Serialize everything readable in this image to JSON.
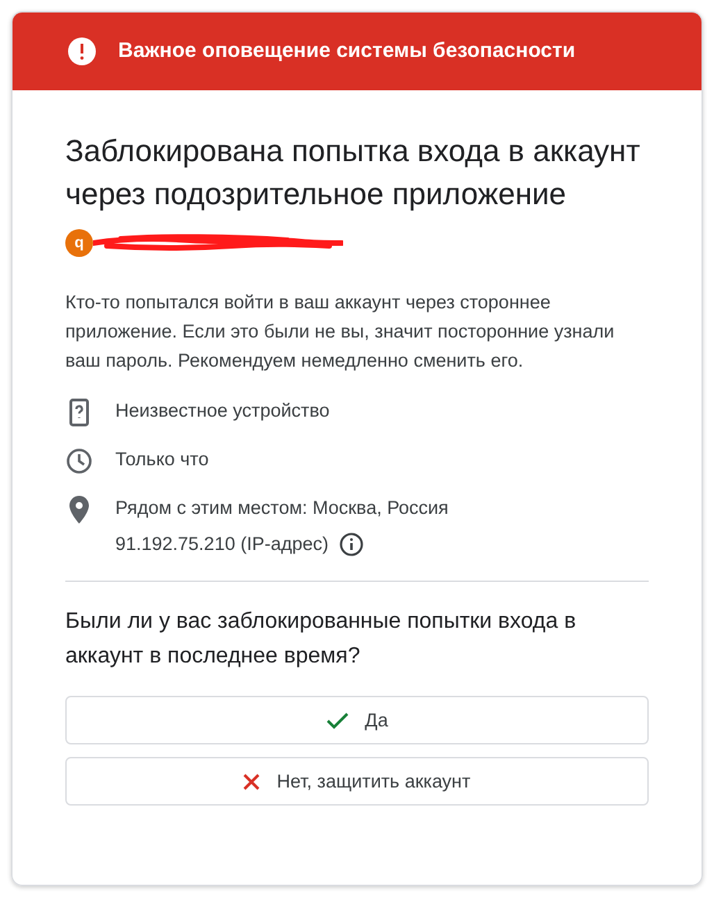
{
  "header": {
    "title": "Важное оповещение системы безопасности"
  },
  "title": "Заблокирована попытка входа в аккаунт через подозрительное приложение",
  "account": {
    "avatar_letter": "q"
  },
  "message": "Кто-то попытался войти в ваш аккаунт через стороннее приложение. Если это были не вы, значит посторонние узнали ваш пароль. Рекомендуем немедленно сменить его.",
  "details": [
    {
      "kind": "device",
      "text": "Неизвестное устройство"
    },
    {
      "kind": "time",
      "text": "Только что"
    },
    {
      "kind": "location",
      "text": "Рядом с этим местом: Москва, Россия",
      "subtext": "91.192.75.210 (IP-адрес)"
    }
  ],
  "question": "Были ли у вас заблокированные попытки входа в аккаунт в последнее время?",
  "buttons": [
    {
      "kind": "yes",
      "label": "Да"
    },
    {
      "kind": "no",
      "label": "Нет, защитить аккаунт"
    }
  ]
}
